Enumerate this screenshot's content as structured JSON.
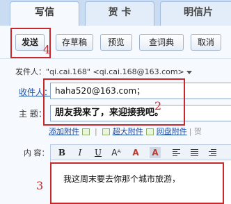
{
  "tabs": [
    {
      "label": "写信"
    },
    {
      "label": "贺 卡"
    },
    {
      "label": "明信片"
    }
  ],
  "toolbar": {
    "send_label": "发送",
    "draft_label": "存草稿",
    "preview_label": "预览",
    "dict_label": "查词典",
    "cancel_label": "取消"
  },
  "sender": {
    "label": "发件人：",
    "value": "\"qi.cai.168\" <qi.cai.168@163.com>"
  },
  "recipient": {
    "label": "收件人：",
    "value": "haha520@163.com；"
  },
  "subject": {
    "label": "主 题：",
    "value": "朋友我来了，来迎接我吧。"
  },
  "attachments": {
    "add_attachment": "添加附件",
    "super_attachment": "超大附件",
    "netdisk_attachment": "网盘附件",
    "tail": "| 贺"
  },
  "editor": {
    "label": "内 容：",
    "toolbar": {
      "bold": "B",
      "italic": "I",
      "underline": "U",
      "size": "Aᴬ",
      "color": "A",
      "bgcolor": "A"
    },
    "body_text": "我这周末要去你那个城市旅游，"
  },
  "annotations": {
    "n4": "4",
    "n2": "2",
    "n3": "3"
  },
  "colors": {
    "annotation": "#c8282c",
    "link": "#1a4ea8",
    "tab_bg": "#c9dcf2"
  }
}
